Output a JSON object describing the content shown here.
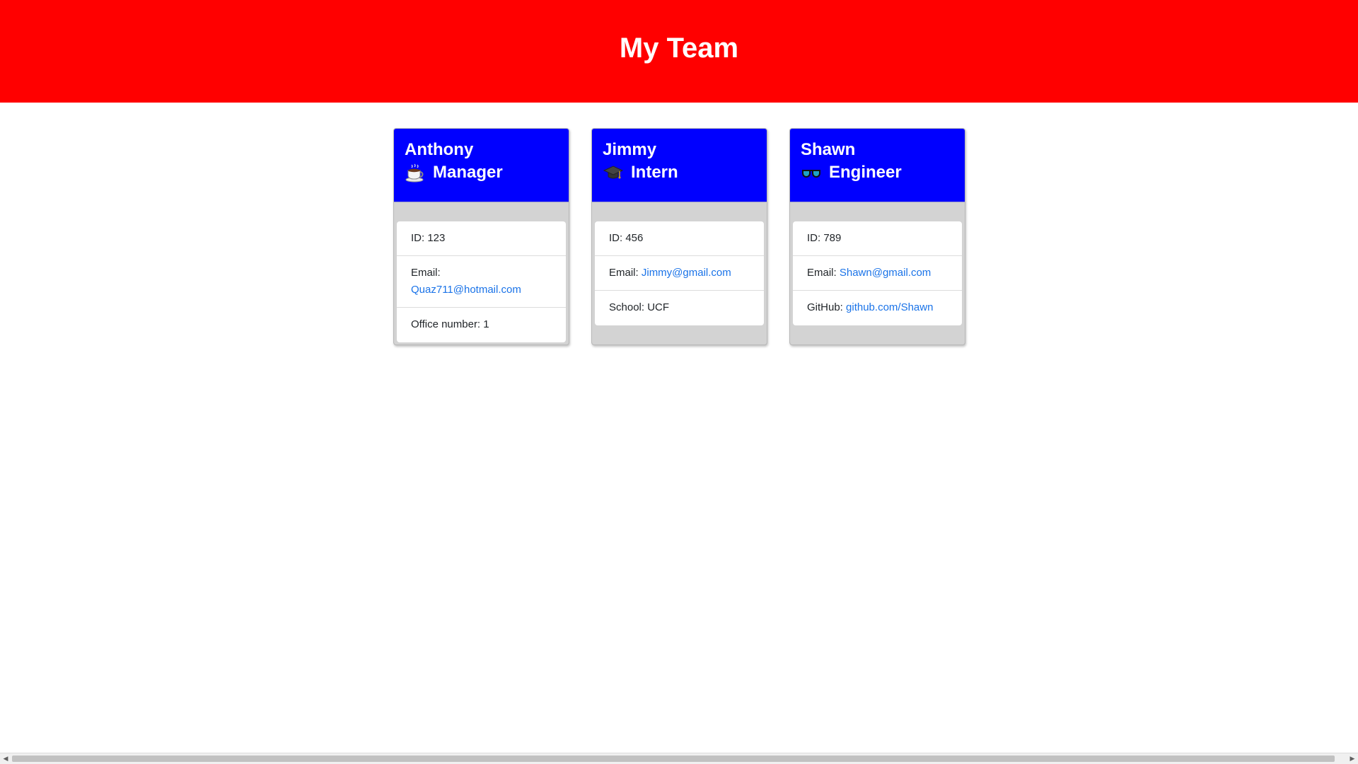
{
  "page": {
    "title": "My Team"
  },
  "colors": {
    "header_bg": "#ff0000",
    "card_head_bg": "#0000ff",
    "card_body_bg": "#d3d3d3",
    "link": "#1a73e8"
  },
  "cards": [
    {
      "name": "Anthony",
      "role": "Manager",
      "role_icon": "coffee-cup-icon",
      "id_text": "ID: 123",
      "email_label": "Email:",
      "email": "Quaz711@hotmail.com",
      "extra_label": "Office number: 1",
      "extra_value": ""
    },
    {
      "name": "Jimmy",
      "role": "Intern",
      "role_icon": "graduation-cap-icon",
      "id_text": "ID: 456",
      "email_label": "Email:",
      "email": "Jimmy@gmail.com",
      "extra_label": "School: UCF",
      "extra_value": ""
    },
    {
      "name": "Shawn",
      "role": "Engineer",
      "role_icon": "glasses-icon",
      "id_text": "ID: 789",
      "email_label": "Email:",
      "email": "Shawn@gmail.com",
      "extra_label": "GitHub:",
      "extra_value": "github.com/Shawn"
    }
  ]
}
